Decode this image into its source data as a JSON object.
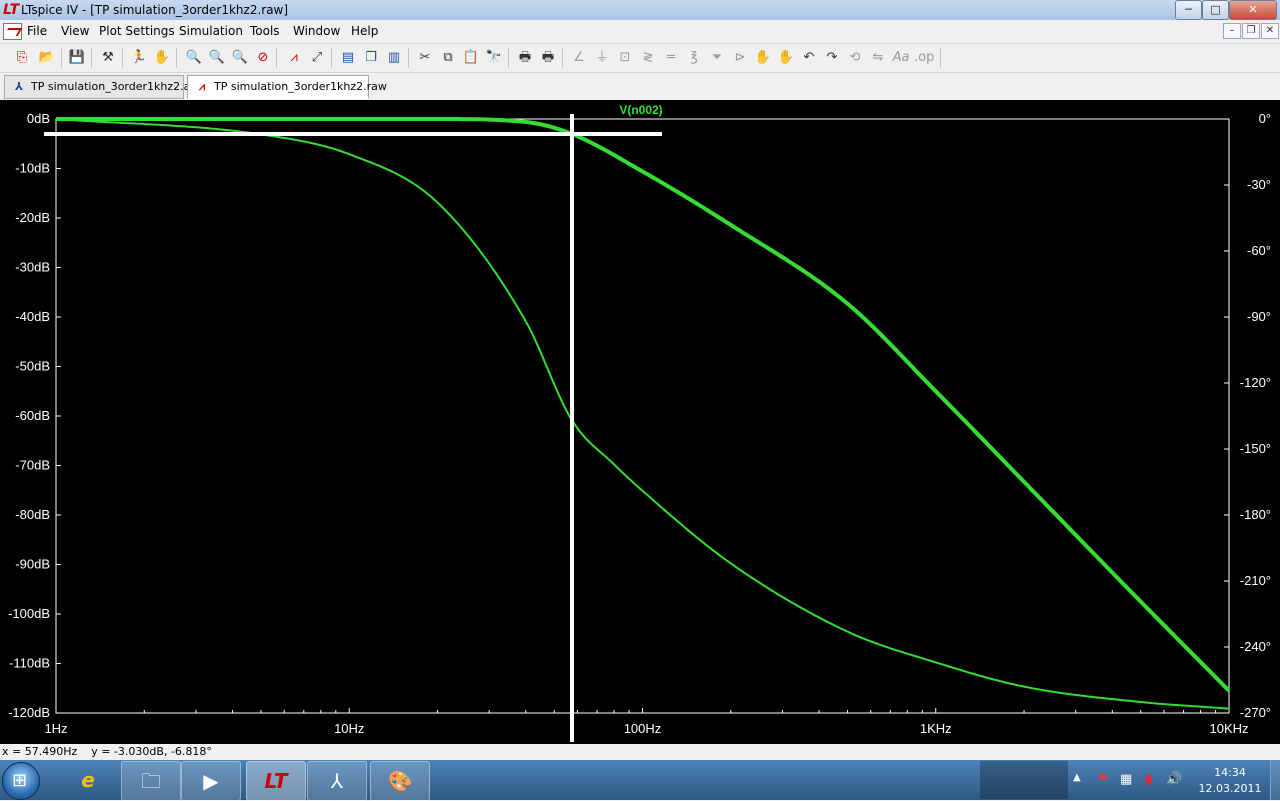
{
  "window": {
    "title": "LTspice IV - [TP simulation_3order1khz2.raw]",
    "title_icon": "ltspice-logo",
    "controls": {
      "minimize": "─",
      "maximize": "□",
      "close": "✕"
    }
  },
  "menu": {
    "items": [
      "File",
      "View",
      "Plot Settings",
      "Simulation",
      "Tools",
      "Window",
      "Help"
    ],
    "mdi_controls": {
      "minimize": "–",
      "restore": "❐",
      "close": "✕"
    }
  },
  "toolbar": {
    "icons": [
      "new-schematic-icon",
      "open-icon",
      "save-icon",
      "control-panel-icon",
      "run-icon",
      "halt-icon",
      "zoom-in-icon",
      "zoom-area-icon",
      "zoom-out-icon",
      "zoom-fit-icon",
      "autorange-icon",
      "vertical-autorange-icon",
      "tile-horizontal-icon",
      "cascade-icon",
      "tile-vertical-icon",
      "cut-icon",
      "copy-icon",
      "paste-icon",
      "find-icon",
      "print-setup-icon",
      "print-icon",
      "wire-icon",
      "ground-icon",
      "label-icon",
      "resistor-icon",
      "capacitor-icon",
      "inductor-icon",
      "diode-icon",
      "component-icon",
      "move-icon",
      "drag-icon",
      "undo-icon",
      "redo-icon",
      "rotate-icon",
      "mirror-icon",
      "text-icon",
      "spice-directive-icon"
    ]
  },
  "tabs": [
    {
      "label": "TP simulation_3order1khz2.asc",
      "icon": "schematic-icon",
      "active": false
    },
    {
      "label": "TP simulation_3order1khz2.raw",
      "icon": "waveform-icon",
      "active": true
    }
  ],
  "plot": {
    "trace_label": "V(n002)",
    "colors": {
      "background": "#000000",
      "trace": "#33dd33",
      "cursor": "#ffffff",
      "axis_text": "#ffffff",
      "grid_frame": "#ffffff"
    }
  },
  "chart_data": {
    "type": "line",
    "title": "V(n002)",
    "xscale": "log",
    "xlim": [
      1,
      10000
    ],
    "x_ticks": [
      "1Hz",
      "10Hz",
      "100Hz",
      "1KHz",
      "10KHz"
    ],
    "y_left_ticks": [
      "0dB",
      "-10dB",
      "-20dB",
      "-30dB",
      "-40dB",
      "-50dB",
      "-60dB",
      "-70dB",
      "-80dB",
      "-90dB",
      "-100dB",
      "-110dB",
      "-120dB"
    ],
    "y_left_lim": [
      -120,
      0
    ],
    "y_right_ticks": [
      "0°",
      "-30°",
      "-60°",
      "-90°",
      "-120°",
      "-150°",
      "-180°",
      "-210°",
      "-240°",
      "-270°"
    ],
    "y_right_lim": [
      -270,
      0
    ],
    "series": [
      {
        "name": "V(n002)",
        "axis": "magnitude_dB",
        "style": "thick",
        "x": [
          1,
          10,
          20,
          40,
          57.49,
          100,
          200,
          500,
          1000,
          2000,
          5000,
          10000
        ],
        "y": [
          0,
          0,
          0,
          -0.6,
          -3.03,
          -10.6,
          -21.4,
          -37.3,
          -55,
          -73.3,
          -97.5,
          -115.5
        ]
      },
      {
        "name": "V(n002)",
        "axis": "phase_deg",
        "style": "thin",
        "x": [
          1,
          5,
          10,
          20,
          40,
          57.49,
          80,
          100,
          200,
          500,
          1000,
          2000,
          5000,
          10000
        ],
        "y": [
          0,
          -7,
          -16,
          -38,
          -92,
          -137,
          -157,
          -169,
          -202,
          -233,
          -247,
          -258,
          -265,
          -268
        ]
      }
    ],
    "cursor": {
      "x": 57.49,
      "y_db": -3.03,
      "phase_deg": -6.818
    }
  },
  "status": {
    "text": "x = 57.490Hz    y = -3.030dB, -6.818°"
  },
  "taskbar": {
    "start_icon": "⊞",
    "tasks": [
      {
        "name": "internet-explorer",
        "glyph": "e"
      },
      {
        "name": "windows-explorer",
        "glyph": "🗀"
      },
      {
        "name": "media-player",
        "glyph": "▶"
      },
      {
        "name": "ltspice",
        "glyph": "LT"
      },
      {
        "name": "adobe-reader",
        "glyph": "⅄"
      },
      {
        "name": "paint",
        "glyph": "🎨"
      }
    ],
    "tray": {
      "arrow": "▲",
      "flag": "⚑",
      "network": "▦",
      "signal": "▮",
      "volume": "🔊"
    },
    "time": "14:34",
    "date": "12.03.2011"
  }
}
